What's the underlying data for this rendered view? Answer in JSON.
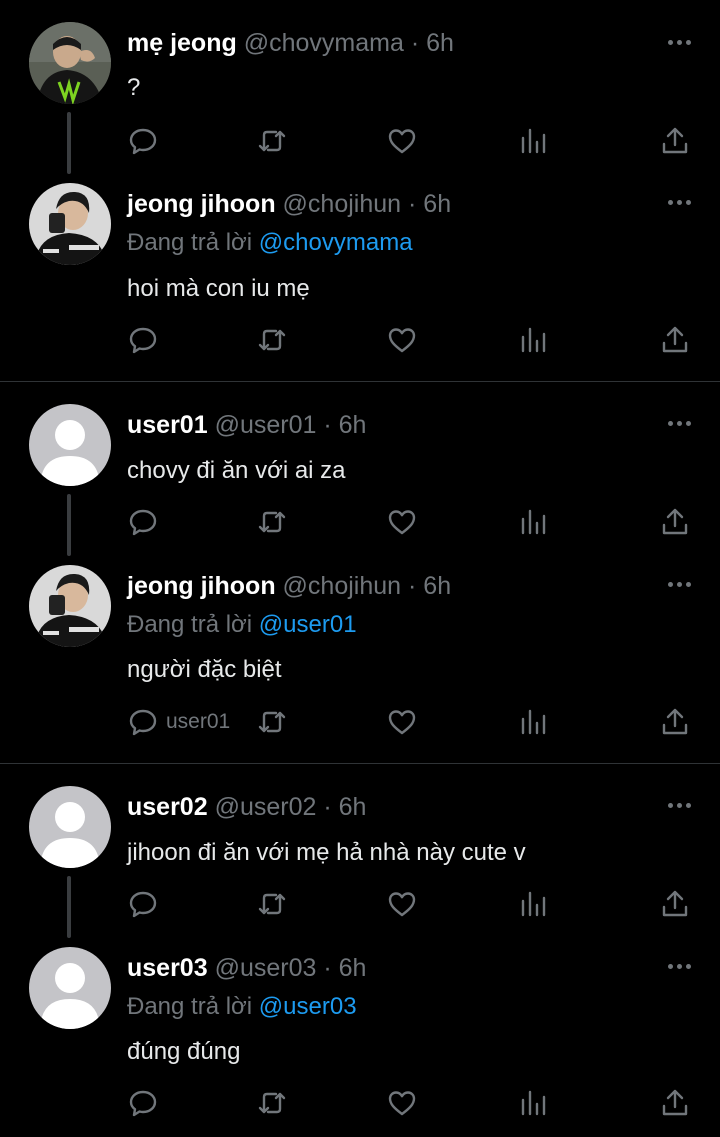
{
  "icons": {
    "reply": "reply-icon",
    "retweet": "retweet-icon",
    "like": "heart-icon",
    "views": "views-icon",
    "share": "share-icon",
    "more": "more-icon"
  },
  "colors": {
    "background": "#000000",
    "name": "#ffffff",
    "muted": "#71767b",
    "mention": "#1d9bf0",
    "divider": "#2f3336"
  },
  "tweets": [
    {
      "name": "mẹ jeong",
      "handle": "@chovymama",
      "time": "· 6h",
      "reply_prefix": "",
      "reply_mention": "",
      "text": "?",
      "reply_count": ""
    },
    {
      "name": "jeong jihoon",
      "handle": "@chojihun",
      "time": "· 6h",
      "reply_prefix": "Đang trả lời",
      "reply_mention": "@chovymama",
      "text": "hoi mà con iu mẹ",
      "reply_count": ""
    },
    {
      "name": "user01",
      "handle": "@user01",
      "time": "· 6h",
      "reply_prefix": "",
      "reply_mention": "",
      "text": "chovy đi ăn với ai za",
      "reply_count": ""
    },
    {
      "name": "jeong jihoon",
      "handle": "@chojihun",
      "time": "· 6h",
      "reply_prefix": "Đang trả lời",
      "reply_mention": "@user01",
      "text": "người đặc biệt",
      "reply_count": "user01"
    },
    {
      "name": "user02",
      "handle": "@user02",
      "time": "· 6h",
      "reply_prefix": "",
      "reply_mention": "",
      "text": "jihoon đi ăn với mẹ hả nhà này cute v",
      "reply_count": ""
    },
    {
      "name": "user03",
      "handle": "@user03",
      "time": "· 6h",
      "reply_prefix": "Đang trả lời",
      "reply_mention": "@user03",
      "text": "đúng đúng",
      "reply_count": ""
    }
  ]
}
